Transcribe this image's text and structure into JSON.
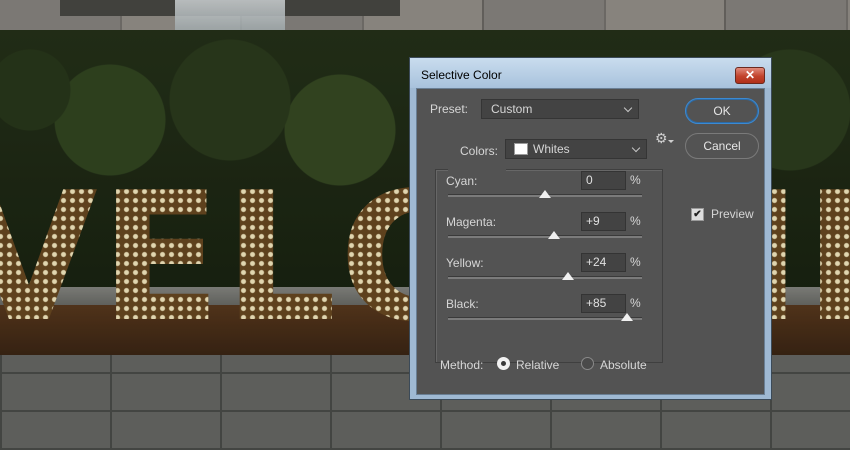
{
  "background": {
    "sign_text": "VELCOME"
  },
  "dialog": {
    "title": "Selective Color",
    "close_label": "✕",
    "preset": {
      "label": "Preset:",
      "value": "Custom"
    },
    "colors": {
      "label": "Colors:",
      "value": "Whites",
      "swatch_color": "#ffffff"
    },
    "buttons": {
      "ok": "OK",
      "cancel": "Cancel"
    },
    "preview": {
      "label": "Preview",
      "checked": true,
      "check_glyph": "✔"
    },
    "sliders": [
      {
        "label": "Cyan:",
        "value": "0",
        "unit": "%",
        "level": 0
      },
      {
        "label": "Magenta:",
        "value": "+9",
        "unit": "%",
        "level": 9
      },
      {
        "label": "Yellow:",
        "value": "+24",
        "unit": "%",
        "level": 24
      },
      {
        "label": "Black:",
        "value": "+85",
        "unit": "%",
        "level": 85
      }
    ],
    "method": {
      "label": "Method:",
      "options": [
        "Relative",
        "Absolute"
      ],
      "selected": "Relative"
    },
    "colors_accent": {
      "ok_border": "#3b8ad3",
      "close_button": "#c2432c"
    }
  }
}
